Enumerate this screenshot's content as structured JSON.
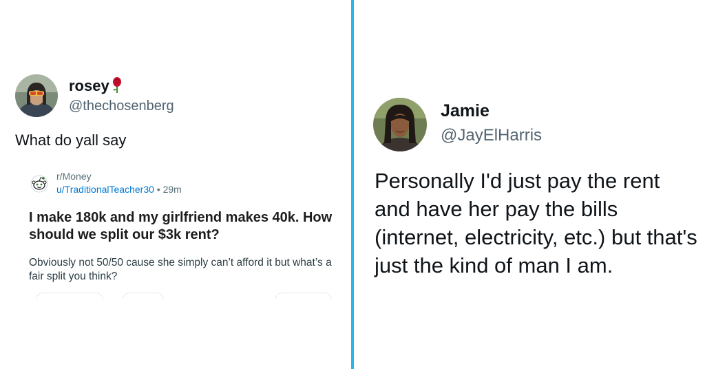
{
  "left_tweet": {
    "display_name": "rosey",
    "handle": "@thechosenberg",
    "text": "What do yall say",
    "name_emoji_icon": "rose-icon",
    "reddit_post": {
      "subreddit": "r/Money",
      "username": "u/TraditionalTeacher30",
      "separator": "•",
      "age": "29m",
      "title": "I make 180k and my girlfriend makes 40k. How should we split our $3k rent?",
      "body": "Obviously not 50/50 cause she simply can’t afford it but what’s a fair split you think?"
    }
  },
  "right_tweet": {
    "display_name": "Jamie",
    "handle": "@JayElHarris",
    "text": "Personally I'd just pay the rent and have her pay the bills (internet, electricity, etc.) but that's just the kind of man I am."
  },
  "colors": {
    "divider": "#2bb7e6",
    "handle_gray": "#536471",
    "reddit_link_blue": "#0079d3",
    "rose_red": "#c8102e"
  }
}
